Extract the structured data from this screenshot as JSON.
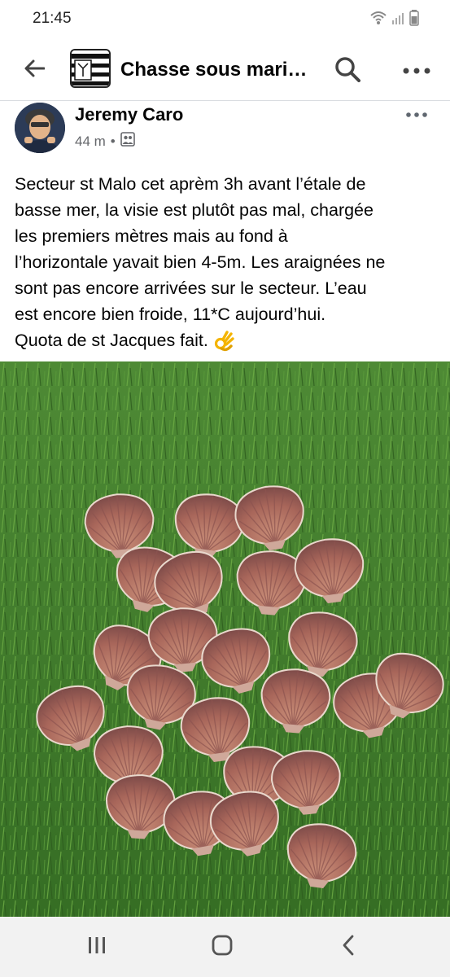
{
  "status_bar": {
    "time": "21:45",
    "icons": [
      "wifi-icon",
      "signal-icon",
      "battery-icon"
    ]
  },
  "app_bar": {
    "title": "Chasse sous mari…",
    "icons": [
      "back-arrow-icon",
      "group-logo",
      "search-icon",
      "more-icon"
    ]
  },
  "post": {
    "author": "Jeremy Caro",
    "time": "44 m",
    "separator": "•",
    "audience_icon": "group-audience-icon",
    "text_lines": [
      "Secteur st Malo cet aprèm 3h avant l’étale de",
      "basse mer, la visie est plutôt pas mal, chargée",
      "les premiers mètres mais au fond à",
      "l’horizontale yavait bien 4-5m. Les araignées ne",
      "sont pas encore arrivées sur le secteur. L’eau",
      "est encore bien froide, 11*C aujourd’hui.",
      "Quota de st Jacques fait."
    ],
    "emoji": "ok-hand-emoji",
    "photo": "scallop-shells-on-grass-photo"
  },
  "nav_bar": {
    "icons": [
      "recent-apps-icon",
      "home-icon",
      "back-icon"
    ]
  },
  "colors": {
    "text_primary": "#050505",
    "text_secondary": "#65676b",
    "grass": "#3f7a2c",
    "shell": "#b7705a",
    "nav_bg": "#f2f2f2"
  }
}
